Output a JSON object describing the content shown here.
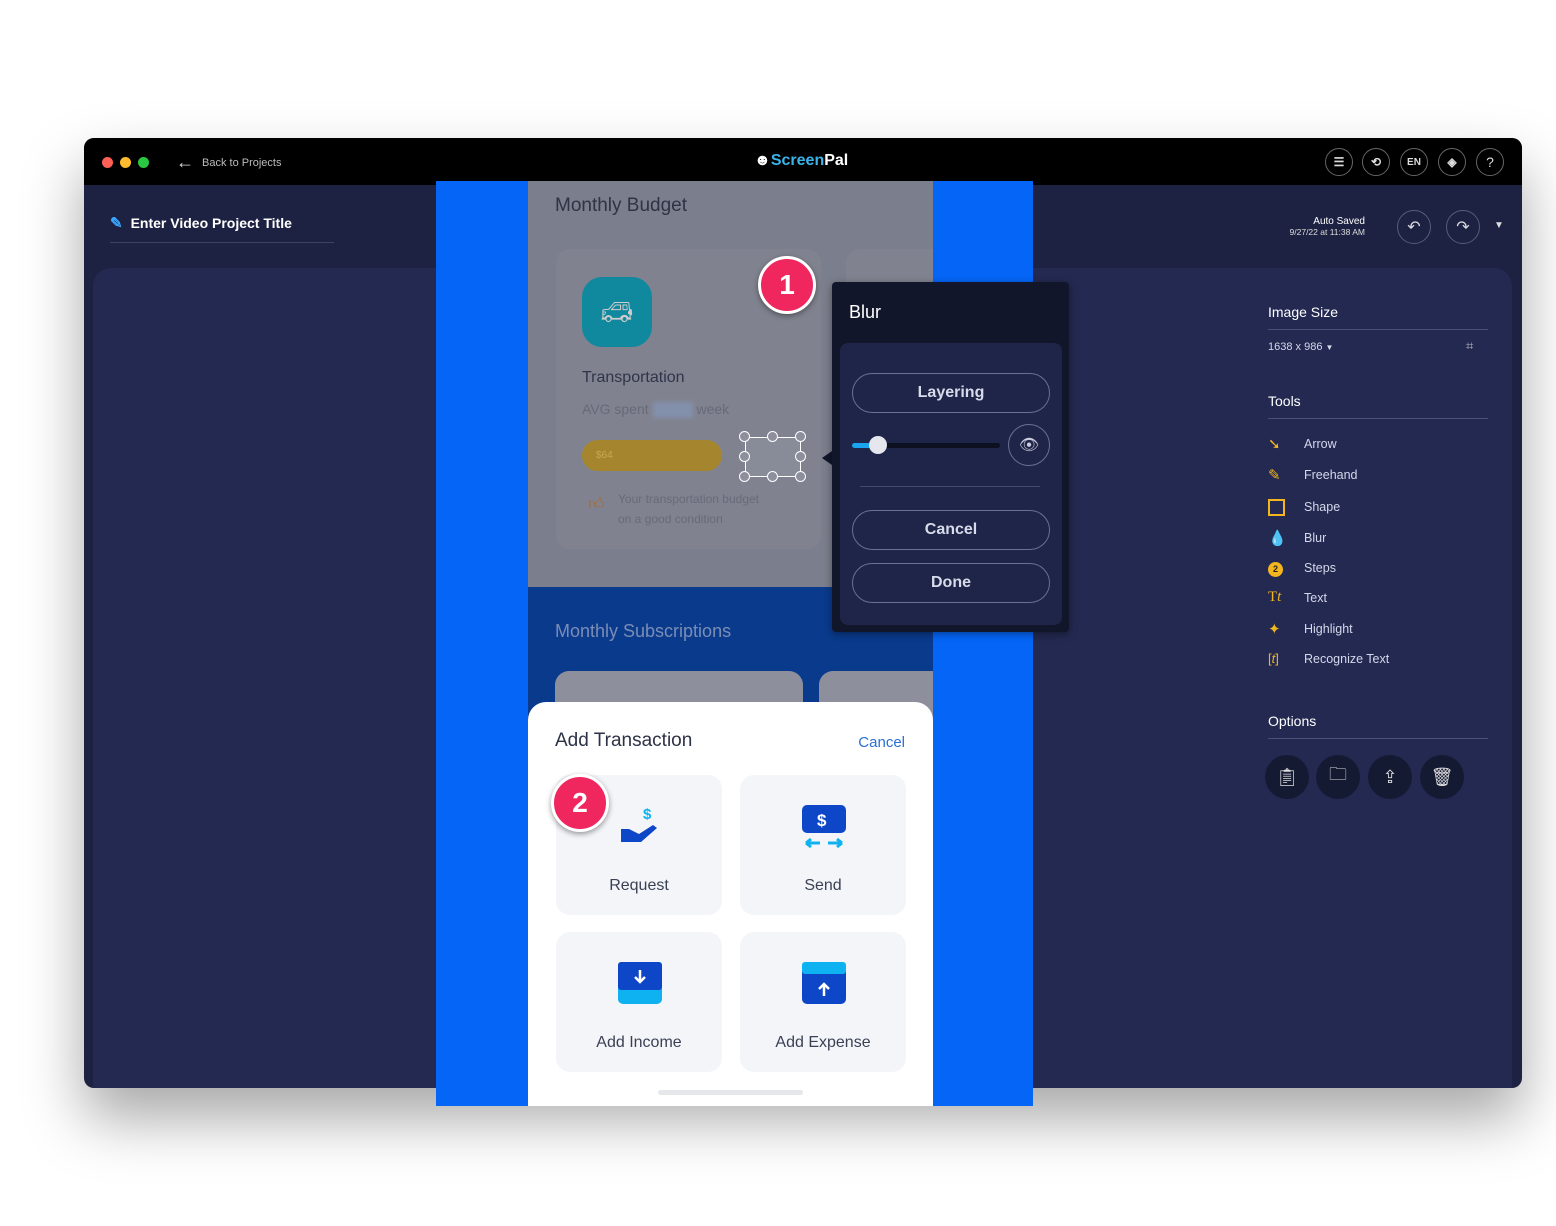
{
  "titlebar": {
    "back_label": "Back to  Projects",
    "logo_prefix": "Screen",
    "logo_suffix": "Pal",
    "icons": [
      "checklist-icon",
      "history-icon",
      "language",
      "layers-icon",
      "help-icon"
    ],
    "language": "EN",
    "help": "?"
  },
  "project": {
    "title": "Enter Video Project Title",
    "auto_saved": "Auto Saved",
    "saved_at": "9/27/22 at 11:38 AM"
  },
  "right_panel": {
    "image_size_label": "Image Size",
    "image_size_value": "1638 x 986",
    "tools_label": "Tools",
    "tools": [
      {
        "label": "Arrow",
        "icon": "arrow-icon"
      },
      {
        "label": "Freehand",
        "icon": "freehand-icon"
      },
      {
        "label": "Shape",
        "icon": "shape-icon"
      },
      {
        "label": "Blur",
        "icon": "blur-icon"
      },
      {
        "label": "Steps",
        "icon": "steps-icon"
      },
      {
        "label": "Text",
        "icon": "text-icon"
      },
      {
        "label": "Highlight",
        "icon": "highlight-icon"
      },
      {
        "label": "Recognize Text",
        "icon": "recognize-text-icon"
      }
    ],
    "options_label": "Options",
    "options": [
      "clipboard-icon",
      "folder-icon",
      "upload-icon",
      "trash-icon"
    ]
  },
  "blur_panel": {
    "title": "Blur",
    "layering": "Layering",
    "slider_value_percent": 15,
    "cancel": "Cancel",
    "done": "Done"
  },
  "app_screen": {
    "monthly_budget": "Monthly Budget",
    "card_title": "Transportation",
    "avg_prefix": "AVG spent",
    "avg_suffix": "week",
    "pill_value": "$64",
    "tip_line1": "Your transportation budget",
    "tip_line2": "on a good condition",
    "monthly_subscriptions": "Monthly Subscriptions",
    "sheet_title": "Add Transaction",
    "sheet_cancel": "Cancel",
    "tiles": [
      {
        "label": "Request"
      },
      {
        "label": "Send"
      },
      {
        "label": "Add Income"
      },
      {
        "label": "Add Expense"
      }
    ]
  },
  "steps": [
    "1",
    "2"
  ],
  "colors": {
    "accent": "#0565f6",
    "step": "#f0275f",
    "tool_icon": "#f3b61f",
    "link": "#2a6fd1"
  }
}
